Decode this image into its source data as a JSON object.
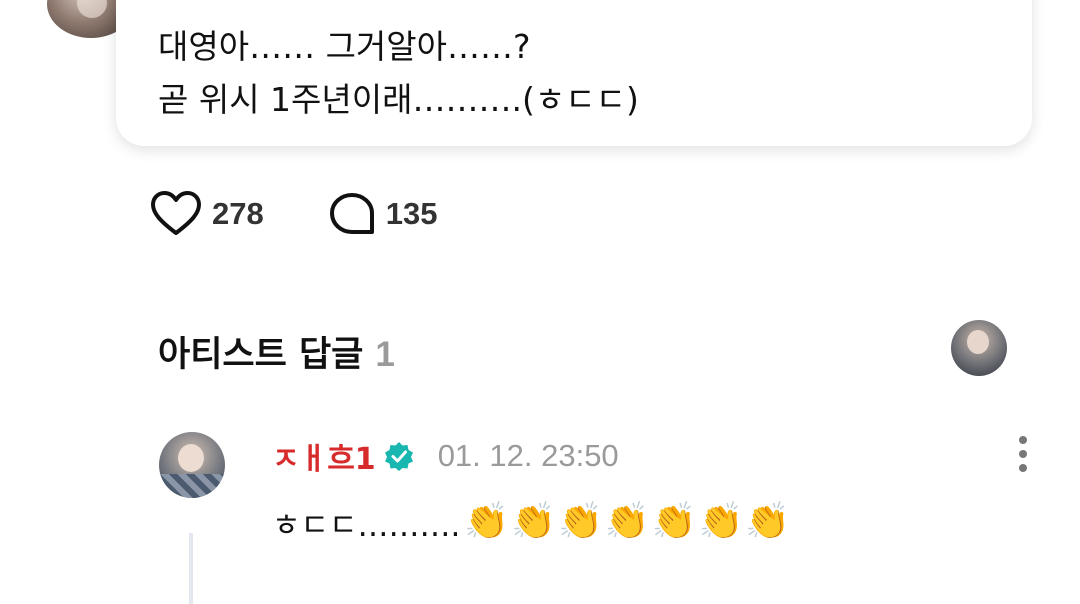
{
  "post": {
    "line1": "대영아…… 그거알아……?",
    "line2": "곧 위시 1주년이래……….(ㅎㄷㄷ)"
  },
  "reactions": {
    "likes": "278",
    "comments": "135"
  },
  "artist_replies": {
    "title": "아티스트 답글",
    "count": "1"
  },
  "comment": {
    "username": "ㅈㅐ흐1",
    "timestamp": "01. 12. 23:50",
    "text": "ㅎㄷㄷ……….",
    "emoji": [
      "👏",
      "👏",
      "👏",
      "👏",
      "👏",
      "👏",
      "👏"
    ]
  },
  "colors": {
    "username": "#d72a2a",
    "verified": "#1ab6b0",
    "muted": "#9a9a9a"
  },
  "icons": [
    "heart-icon",
    "comment-bubble-icon",
    "verified-badge-icon",
    "more-vertical-icon"
  ]
}
